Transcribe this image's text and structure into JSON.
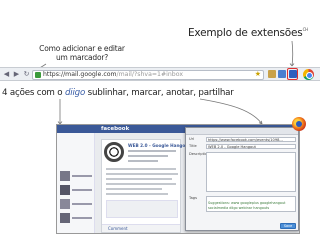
{
  "annotations": {
    "how_to_add_line1": "Como adicionar e editar",
    "how_to_add_line2": "um marcador?",
    "extension_example": "Exemplo de extensões",
    "extension_mark": "CH",
    "actions_prefix": "4 ações com o ",
    "actions_brand": "diigo",
    "actions_suffix": " sublinhar, marcar, anotar, partilhar"
  },
  "browser": {
    "url_host": "https://mail.google.com",
    "url_path": "/mail/?shva=1#inbox"
  },
  "screenshot": {
    "social_logo": "facebook",
    "post_author": "WEB 2.0 - Google Hangout",
    "post_bar_label": "Comment",
    "dialog": {
      "url_label": "Url",
      "url_value": "https://www.facebook.com/events/1098...",
      "title_label": "Title",
      "title_value": "WEB 2.0 - Google Hangout",
      "description_label": "Description",
      "tags_label": "Tags",
      "tags_value": "Suggestions: www googleplus googlehangout socialmedia diigo webinar hangouts",
      "save_label": "Save"
    }
  },
  "colors": {
    "facebook_blue": "#3b5998",
    "highlight_red": "#e03030",
    "arrow": "#777777"
  }
}
